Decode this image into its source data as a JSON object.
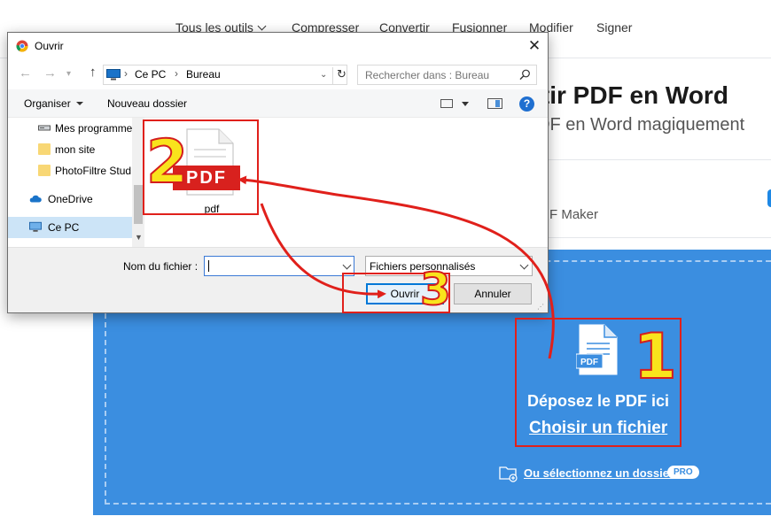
{
  "website": {
    "nav": [
      "Tous les outils",
      "Compresser",
      "Convertir",
      "Fusionner",
      "Modifier",
      "Signer"
    ],
    "hero_title": "rtir PDF en Word",
    "hero_subtitle": "DF en Word magiquement",
    "tab_label": "F Maker",
    "drop_text": "Déposez le PDF ici",
    "choose_file": "Choisir un fichier",
    "select_folder": "Ou sélectionnez un dossier",
    "pro_badge": "PRO",
    "file_icon_badge": "PDF",
    "accent_color": "#3b8ee0"
  },
  "dialog": {
    "title": "Ouvrir",
    "close": "✕",
    "breadcrumb": [
      "Ce PC",
      "Bureau"
    ],
    "search_placeholder": "Rechercher dans : Bureau",
    "toolbar": {
      "organize": "Organiser",
      "new_folder": "Nouveau dossier",
      "help": "?"
    },
    "tree": [
      {
        "label": "Mes programme",
        "icon": "drive-icon"
      },
      {
        "label": "mon site",
        "icon": "folder-icon"
      },
      {
        "label": "PhotoFiltre Stud",
        "icon": "folder-icon"
      },
      {
        "label": "OneDrive",
        "icon": "cloud-icon"
      },
      {
        "label": "Ce PC",
        "icon": "computer-icon",
        "selected": true
      }
    ],
    "file": {
      "name": "pdf",
      "badge": "PDF"
    },
    "filename_label": "Nom du fichier :",
    "filename_value": "",
    "filetype": "Fichiers personnalisés",
    "open_button": "Ouvrir",
    "cancel_button": "Annuler"
  },
  "annotations": {
    "step1": "1",
    "step2": "2",
    "step3": "3",
    "color": "#e0201b"
  }
}
